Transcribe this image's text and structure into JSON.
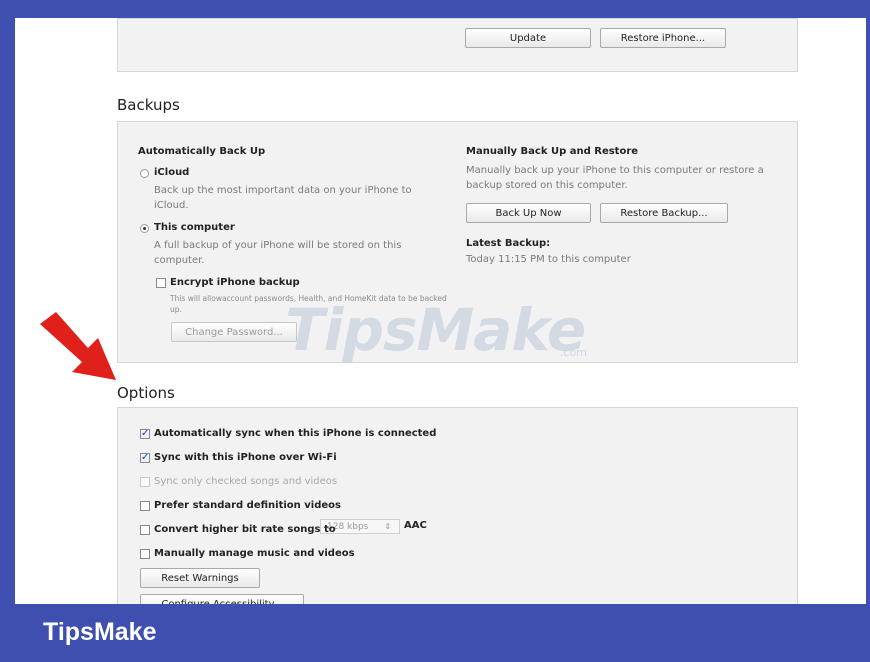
{
  "top_buttons": {
    "update": "Update",
    "restore": "Restore iPhone..."
  },
  "backups": {
    "title": "Backups",
    "auto": {
      "heading": "Automatically Back Up",
      "icloud_label": "iCloud",
      "icloud_desc": "Back up the most important data on your iPhone to iCloud.",
      "computer_label": "This computer",
      "computer_desc": "A full backup of your iPhone will be stored on this computer.",
      "encrypt_label": "Encrypt iPhone backup",
      "encrypt_desc": "This will allowaccount passwords, Health, and HomeKit data to be backed up.",
      "change_password": "Change Password..."
    },
    "manual": {
      "heading": "Manually Back Up and Restore",
      "desc": "Manually back up your iPhone to this computer or restore a backup stored on this computer.",
      "back_up_now": "Back Up Now",
      "restore_backup": "Restore Backup...",
      "latest_heading": "Latest Backup:",
      "latest_value": "Today 11:15 PM to this computer"
    }
  },
  "options": {
    "title": "Options",
    "items": [
      {
        "label": "Automatically sync when this iPhone is connected",
        "checked": true,
        "disabled": false
      },
      {
        "label": "Sync with this iPhone over Wi-Fi",
        "checked": true,
        "disabled": false
      },
      {
        "label": "Sync only checked songs and videos",
        "checked": false,
        "disabled": true
      },
      {
        "label": "Prefer standard definition videos",
        "checked": false,
        "disabled": false
      },
      {
        "label": "Convert higher bit rate songs to",
        "checked": false,
        "disabled": false
      },
      {
        "label": "Manually manage music and videos",
        "checked": false,
        "disabled": false
      }
    ],
    "bitrate_value": "128 kbps",
    "bitrate_format": "AAC",
    "reset_warnings": "Reset Warnings",
    "configure_accessibility": "Configure Accessibility..."
  },
  "watermark": {
    "main": "TipsMake",
    "suffix": ".com"
  },
  "footer": {
    "brand": "TipsMake"
  },
  "colors": {
    "frame": "#4050b0",
    "arrow": "#e0201a",
    "footer": "#3e4fb0"
  }
}
